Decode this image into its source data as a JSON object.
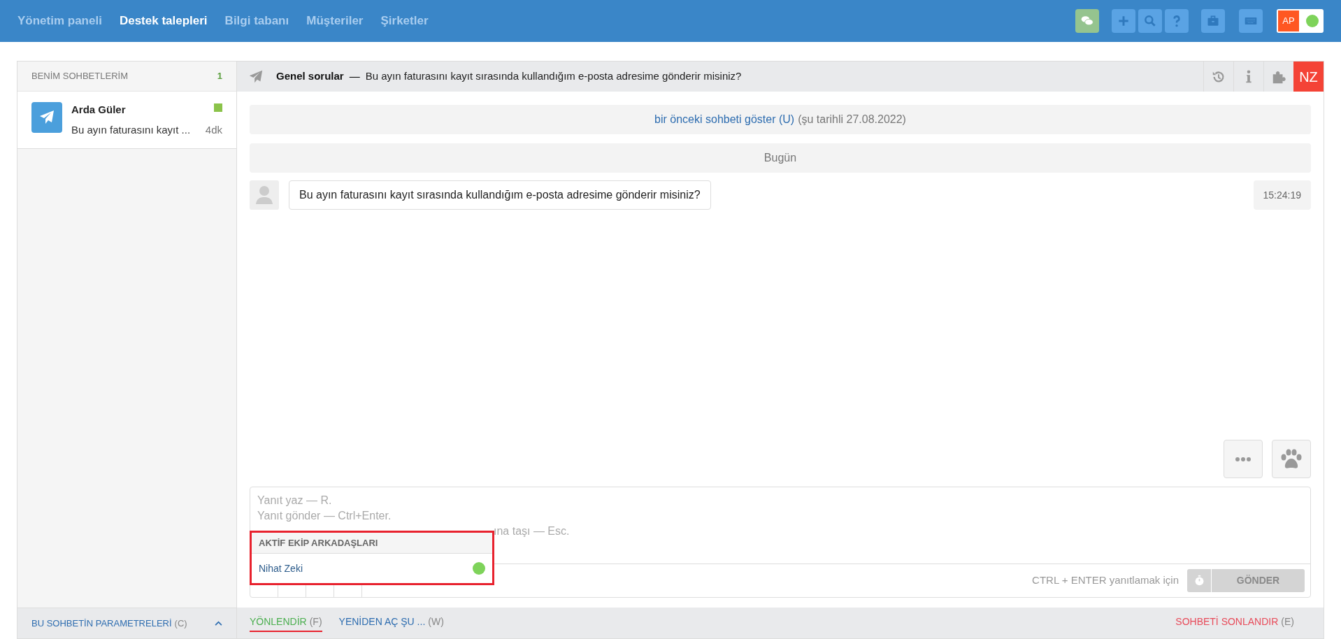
{
  "nav": {
    "items": [
      {
        "label": "Yönetim paneli",
        "selected": false
      },
      {
        "label": "Destek talepleri",
        "selected": true
      },
      {
        "label": "Bilgi tabanı",
        "selected": false
      },
      {
        "label": "Müşteriler",
        "selected": false
      },
      {
        "label": "Şirketler",
        "selected": false
      }
    ],
    "user": {
      "initials": "AP",
      "online": true
    }
  },
  "sidebar": {
    "title": "BENİM SOHBETLERİM",
    "count": "1",
    "chats": [
      {
        "name": "Arda Güler",
        "preview": "Bu ayın faturasını kayıt ...",
        "time": "4dk",
        "color": "#8bc34a",
        "selected": false
      }
    ],
    "params": {
      "label": "BU SOHBETİN PARAMETRELERİ",
      "key": "(C)"
    }
  },
  "chat": {
    "category": "Genel sorular",
    "separator": "—",
    "subject": "Bu ayın faturasını kayıt sırasında kullandığım e-posta adresime gönderir misiniz?",
    "agent_initials": "NZ",
    "history": {
      "link": "bir önceki sohbeti göster (U)",
      "date": "(şu tarihli 27.08.2022)"
    },
    "day": "Bugün",
    "messages": [
      {
        "text": "Bu ayın faturasını kayıt sırasında kullandığım e-posta adresime gönderir misiniz?",
        "time": "15:24:19"
      }
    ]
  },
  "composer": {
    "placeholder": [
      "Yanıt yaz — R.",
      "Yanıt gönder — Ctrl+Enter.",
      "ına taşı — Esc."
    ],
    "hint": "CTRL + ENTER yanıtlamak için",
    "send": "GÖNDER",
    "send_disabled": true,
    "popup": {
      "title": "AKTİF EKİP ARKADAŞLARI",
      "members": [
        {
          "name": "Nihat Zeki",
          "online": true
        }
      ]
    }
  },
  "actions": [
    {
      "kind": "forward",
      "label": "YÖNLENDİR",
      "key": "(F)",
      "selected": true
    },
    {
      "kind": "reopen",
      "label": "YENİDEN AÇ ŞU ...",
      "key": "(W)",
      "selected": false
    },
    {
      "kind": "end",
      "label": "SOHBETİ SONLANDIR",
      "key": "(E)",
      "selected": false
    }
  ]
}
